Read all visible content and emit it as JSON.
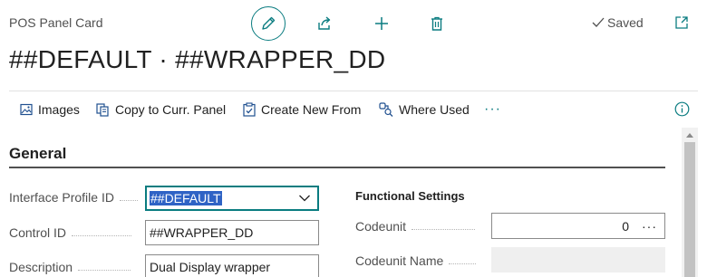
{
  "header": {
    "caption": "POS Panel Card",
    "title": "##DEFAULT · ##WRAPPER_DD",
    "status": "Saved",
    "icons": {
      "edit": "pencil-icon",
      "share": "share-icon",
      "new": "plus-icon",
      "delete": "trash-icon",
      "status": "checkmark-icon",
      "expand": "open-in-new-window-icon"
    }
  },
  "toolbar": {
    "items": [
      {
        "label": "Images",
        "icon": "image-icon"
      },
      {
        "label": "Copy to Curr. Panel",
        "icon": "copy-icon"
      },
      {
        "label": "Create New From",
        "icon": "clipboard-check-icon"
      },
      {
        "label": "Where Used",
        "icon": "link-search-icon"
      }
    ],
    "more": "···",
    "info_icon": "info-icon"
  },
  "general": {
    "title": "General",
    "fields": [
      {
        "label": "Interface Profile ID",
        "value": "##DEFAULT",
        "type": "select"
      },
      {
        "label": "Control ID",
        "value": "##WRAPPER_DD",
        "type": "text"
      },
      {
        "label": "Description",
        "value": "Dual Display wrapper",
        "type": "text"
      }
    ],
    "functional": {
      "title": "Functional Settings",
      "fields": [
        {
          "label": "Codeunit",
          "value": "0",
          "assist": "···",
          "type": "number"
        },
        {
          "label": "Codeunit Name",
          "value": "",
          "type": "readonly"
        }
      ]
    }
  },
  "colors": {
    "accent": "#0a7c80",
    "selection": "#2f63c5",
    "text": "#212121",
    "muted": "#505050"
  }
}
